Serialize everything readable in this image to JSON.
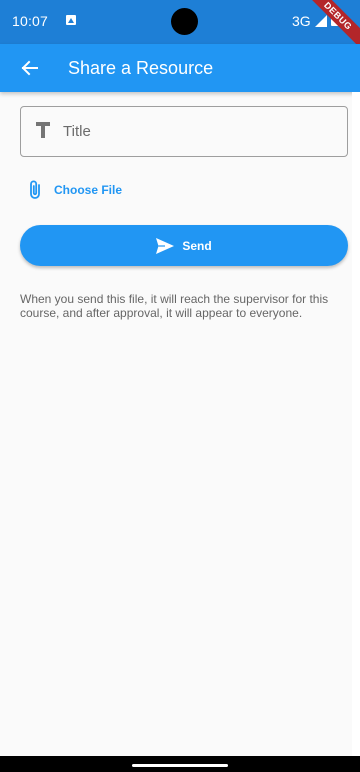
{
  "status_bar": {
    "time": "10:07",
    "network": "3G",
    "debug_banner": "DEBUG",
    "color": "#1e7fd6"
  },
  "app_bar": {
    "title": "Share a Resource",
    "back_icon": "arrow-back-icon",
    "color": "#2196f3"
  },
  "form": {
    "title_field": {
      "placeholder": "Title",
      "value": "",
      "icon": "text-t-icon"
    },
    "choose_file": {
      "label": "Choose File",
      "icon": "paperclip-icon"
    },
    "send_button": {
      "label": "Send",
      "icon": "send-icon"
    },
    "info_text": "When you send this file, it will reach the supervisor for this course, and after approval, it will appear to everyone."
  }
}
